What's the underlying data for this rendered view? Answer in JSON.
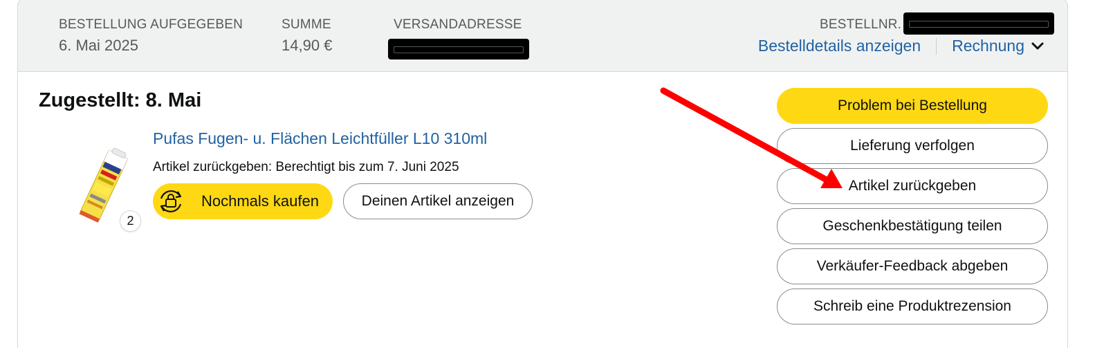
{
  "header": {
    "order_placed_label": "BESTELLUNG AUFGEGEBEN",
    "order_placed_value": "6. Mai 2025",
    "total_label": "SUMME",
    "total_value": "14,90 €",
    "ship_to_label": "VERSANDADRESSE",
    "order_number_label": "BESTELLNR. (",
    "details_link": "Bestelldetails anzeigen",
    "invoice_link": "Rechnung"
  },
  "shipment": {
    "status": "Zugestellt: 8. Mai"
  },
  "item": {
    "title": "Pufas Fugen- u. Flächen Leichtfüller L10 310ml",
    "return_info": "Artikel zurückgeben: Berechtigt bis zum 7. Juni 2025",
    "quantity": "2",
    "buy_again_label": "Nochmals kaufen",
    "view_item_label": "Deinen Artikel anzeigen"
  },
  "actions": [
    {
      "label": "Problem bei Bestellung",
      "name": "problem-button"
    },
    {
      "label": "Lieferung verfolgen",
      "name": "track-package-button"
    },
    {
      "label": "Artikel zurückgeben",
      "name": "return-item-button"
    },
    {
      "label": "Geschenkbestätigung teilen",
      "name": "share-gift-receipt-button"
    },
    {
      "label": "Verkäufer-Feedback abgeben",
      "name": "seller-feedback-button"
    },
    {
      "label": "Schreib eine Produktrezension",
      "name": "write-review-button"
    }
  ],
  "colors": {
    "accent_yellow": "#ffd814",
    "link_blue": "#2162a1",
    "header_bg": "#f0f2f2",
    "annotation_arrow": "#ff0000"
  }
}
